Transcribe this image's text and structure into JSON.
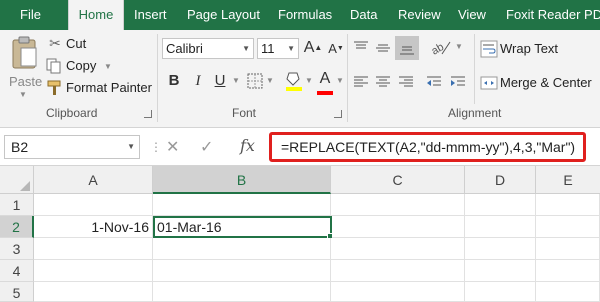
{
  "menu": {
    "tabs": [
      "File",
      "Home",
      "Insert",
      "Page Layout",
      "Formulas",
      "Data",
      "Review",
      "View",
      "Foxit Reader PD"
    ],
    "active_tab": "Home"
  },
  "ribbon": {
    "clipboard": {
      "paste_label": "Paste",
      "cut_label": "Cut",
      "copy_label": "Copy",
      "format_painter_label": "Format Painter",
      "group_label": "Clipboard"
    },
    "font": {
      "font_name": "Calibri",
      "font_size": "11",
      "bold": "B",
      "italic": "I",
      "underline": "U",
      "group_label": "Font",
      "fill_color": "#ffff00",
      "font_color": "#ff0000"
    },
    "alignment": {
      "wrap_text_label": "Wrap Text",
      "merge_center_label": "Merge & Center",
      "group_label": "Alignment"
    }
  },
  "formula_bar": {
    "name_box": "B2",
    "cancel_icon": "✕",
    "enter_icon": "✓",
    "fx_label": "fx",
    "formula": "=REPLACE(TEXT(A2,\"dd-mmm-yy\"),4,3,\"Mar\")",
    "highlight_color": "#e0201e"
  },
  "grid": {
    "columns": [
      "A",
      "B",
      "C",
      "D",
      "E"
    ],
    "rows": [
      "1",
      "2",
      "3",
      "4",
      "5"
    ],
    "cells": {
      "A2": "1-Nov-16",
      "B2": "01-Mar-16"
    },
    "selected_cell": "B2",
    "accent_color": "#217346"
  }
}
